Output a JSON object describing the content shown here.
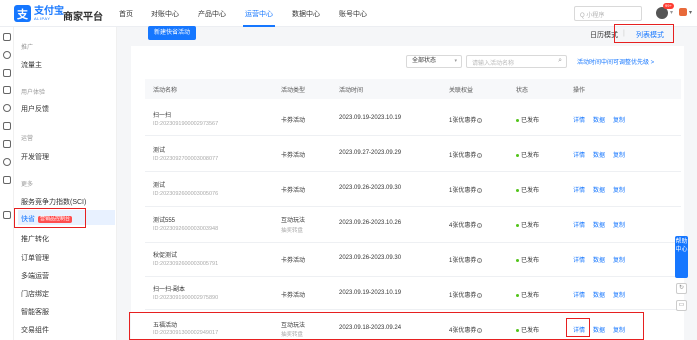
{
  "brand": {
    "logo_cn": "支付宝",
    "logo_en": "ALIPAY",
    "platform": "商家平台"
  },
  "nav": {
    "items": [
      "首页",
      "对账中心",
      "产品中心",
      "运营中心",
      "数据中心",
      "账号中心"
    ],
    "active": "运营中心"
  },
  "search": {
    "placeholder": "Q 小程序"
  },
  "notification_badge": "99+",
  "sidebar": {
    "sections": [
      {
        "heading": "推广",
        "items": [
          "流量主"
        ]
      },
      {
        "heading": "用户体验",
        "items": [
          "用户反馈"
        ]
      },
      {
        "heading": "运营",
        "items": [
          "开发管理"
        ]
      },
      {
        "heading": "更多",
        "items": [
          "服务竞争力指数(SCI)",
          "快省",
          "推广转化",
          "订单管理",
          "多端运营",
          "门店绑定",
          "智能客服",
          "交易组件"
        ]
      }
    ],
    "active_item": "快省",
    "active_tag": "营销品控制台"
  },
  "toolbar": {
    "new_button": "新建快省活动",
    "mode_calendar": "日历模式",
    "mode_separator": "|",
    "mode_list": "列表模式"
  },
  "filters": {
    "status_select": "全部状态",
    "search_placeholder": "请输入活动名称",
    "hint_link": "活动时间中间可调整优先级 >"
  },
  "table": {
    "headers": [
      "活动名称",
      "活动类型",
      "活动时间",
      "关联权益",
      "状态",
      "操作"
    ],
    "rows": [
      {
        "name": "扫一扫",
        "id": "ID:2023091900002973567",
        "type": "卡券活动",
        "type_sub": "",
        "time": "2023.09.19-2023.10.19",
        "benefit": "1张优惠券",
        "status": "已发布",
        "ops": [
          "详情",
          "数据",
          "复制"
        ]
      },
      {
        "name": "测试",
        "id": "ID:2023092700003008077",
        "type": "卡券活动",
        "type_sub": "",
        "time": "2023.09.27-2023.09.29",
        "benefit": "1张优惠券",
        "status": "已发布",
        "ops": [
          "详情",
          "数据",
          "复制"
        ]
      },
      {
        "name": "测试",
        "id": "ID:2023092600003005076",
        "type": "卡券活动",
        "type_sub": "",
        "time": "2023.09.26-2023.09.30",
        "benefit": "1张优惠券",
        "status": "已发布",
        "ops": [
          "详情",
          "数据",
          "复制"
        ]
      },
      {
        "name": "测试555",
        "id": "ID:2023092600003003948",
        "type": "互动玩法",
        "type_sub": "抽奖转盘",
        "time": "2023.09.26-2023.10.26",
        "benefit": "4张优惠券",
        "status": "已发布",
        "ops": [
          "详情",
          "数据",
          "复制"
        ]
      },
      {
        "name": "秋促测试",
        "id": "ID:2023092600003005791",
        "type": "卡券活动",
        "type_sub": "",
        "time": "2023.09.26-2023.09.30",
        "benefit": "1张优惠券",
        "status": "已发布",
        "ops": [
          "详情",
          "数据",
          "复制"
        ]
      },
      {
        "name": "扫一扫-副本",
        "id": "ID:2023091900002975890",
        "type": "卡券活动",
        "type_sub": "",
        "time": "2023.09.19-2023.10.19",
        "benefit": "1张优惠券",
        "status": "已发布",
        "ops": [
          "详情",
          "数据",
          "复制"
        ]
      },
      {
        "name": "五福活动",
        "id": "ID:2023091300002949017",
        "type": "互动玩法",
        "type_sub": "抽奖转盘",
        "time": "2023.09.18-2023.09.24",
        "benefit": "4张优惠券",
        "status": "已发布",
        "ops": [
          "详情",
          "数据",
          "复制"
        ]
      }
    ]
  },
  "help_float": "帮助中心",
  "colors": {
    "accent": "#1677ff",
    "highlight": "#e62020",
    "status_green": "#52c41a"
  }
}
